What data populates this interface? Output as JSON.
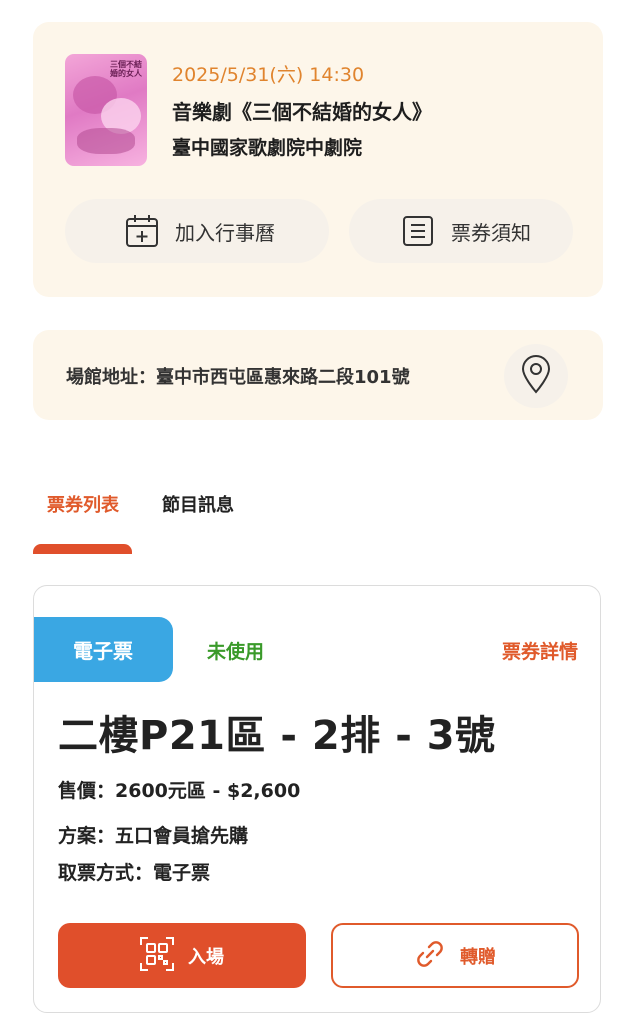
{
  "event": {
    "datetime": "2025/5/31(六) 14:30",
    "title": "音樂劇《三個不結婚的女人》",
    "venue": "臺中國家歌劇院中劇院",
    "poster_text": "三個不結婚的女人",
    "calendar_label": "加入行事曆",
    "notice_label": "票券須知",
    "calendar_icon": "calendar-plus-icon",
    "notice_icon": "list-document-icon"
  },
  "address": {
    "text": "場館地址：臺中市西屯區惠來路二段101號",
    "icon": "map-pin-icon"
  },
  "tabs": [
    {
      "label": "票券列表",
      "active": true
    },
    {
      "label": "節目訊息",
      "active": false
    }
  ],
  "ticket": {
    "type": "電子票",
    "status": "未使用",
    "detail_link": "票券詳情",
    "seat": "二樓P21區 - 2排 - 3號",
    "price": "售價：2600元區 - $2,600",
    "plan": "方案：五口會員搶先購",
    "pickup": "取票方式：電子票",
    "enter_label": "入場",
    "transfer_label": "轉贈",
    "enter_icon": "qr-code-icon",
    "transfer_icon": "link-icon"
  },
  "colors": {
    "accent": "#e04f2b",
    "date_orange": "#e0842e",
    "status_green": "#3a9a2a",
    "eticket_blue": "#3aa7e3",
    "card_bg": "#fdf6ea"
  }
}
